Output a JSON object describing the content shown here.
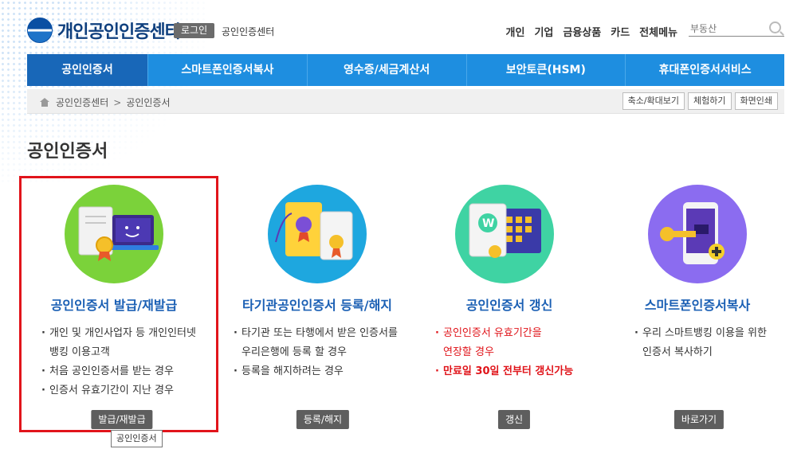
{
  "header": {
    "logo_text": "개인공인인증센터",
    "login_label": "로그인",
    "center_link": "공인인증센터",
    "nav": [
      "개인",
      "기업",
      "금융상품",
      "카드",
      "전체메뉴"
    ],
    "search_placeholder": "부동산"
  },
  "gnb": [
    "공인인증서",
    "스마트폰인증서복사",
    "영수증/세금계산서",
    "보안토큰(HSM)",
    "휴대폰인증서서비스"
  ],
  "breadcrumb": [
    "공인인증센터",
    "공인인증서"
  ],
  "tools": [
    "축소/확대보기",
    "체험하기",
    "화면인쇄"
  ],
  "page_title": "공인인증서",
  "cards": [
    {
      "title": "공인인증서 발급/재발급",
      "items": [
        "개인 및 개인사업자 등 개인인터넷",
        "뱅킹 이용고객",
        "처음 공인인증서를 받는 경우",
        "인증서 유효기간이 지난 경우"
      ],
      "button": "발급/재발급"
    },
    {
      "title": "타기관공인인증서 등록/해지",
      "items": [
        "타기관 또는 타행에서 받은 인증서를",
        "우리은행에 등록 할 경우",
        "등록을 해지하려는 경우"
      ],
      "button": "등록/해지"
    },
    {
      "title": "공인인증서 갱신",
      "items": [
        "공인인증서 유효기간을",
        "연장할 경우",
        "만료일 30일 전부터 갱신가능"
      ],
      "button": "갱신"
    },
    {
      "title": "스마트폰인증서복사",
      "items": [
        "우리 스마트뱅킹 이용을 위한",
        "인증서 복사하기"
      ],
      "button": "바로가기"
    }
  ],
  "tooltip": "공인인증서",
  "colors": {
    "accent": "#1e8ee0",
    "active_menu": "#1867b8",
    "highlight": "#e1141b",
    "title_blue": "#1a5fb4",
    "warning_red": "#e0141a"
  }
}
